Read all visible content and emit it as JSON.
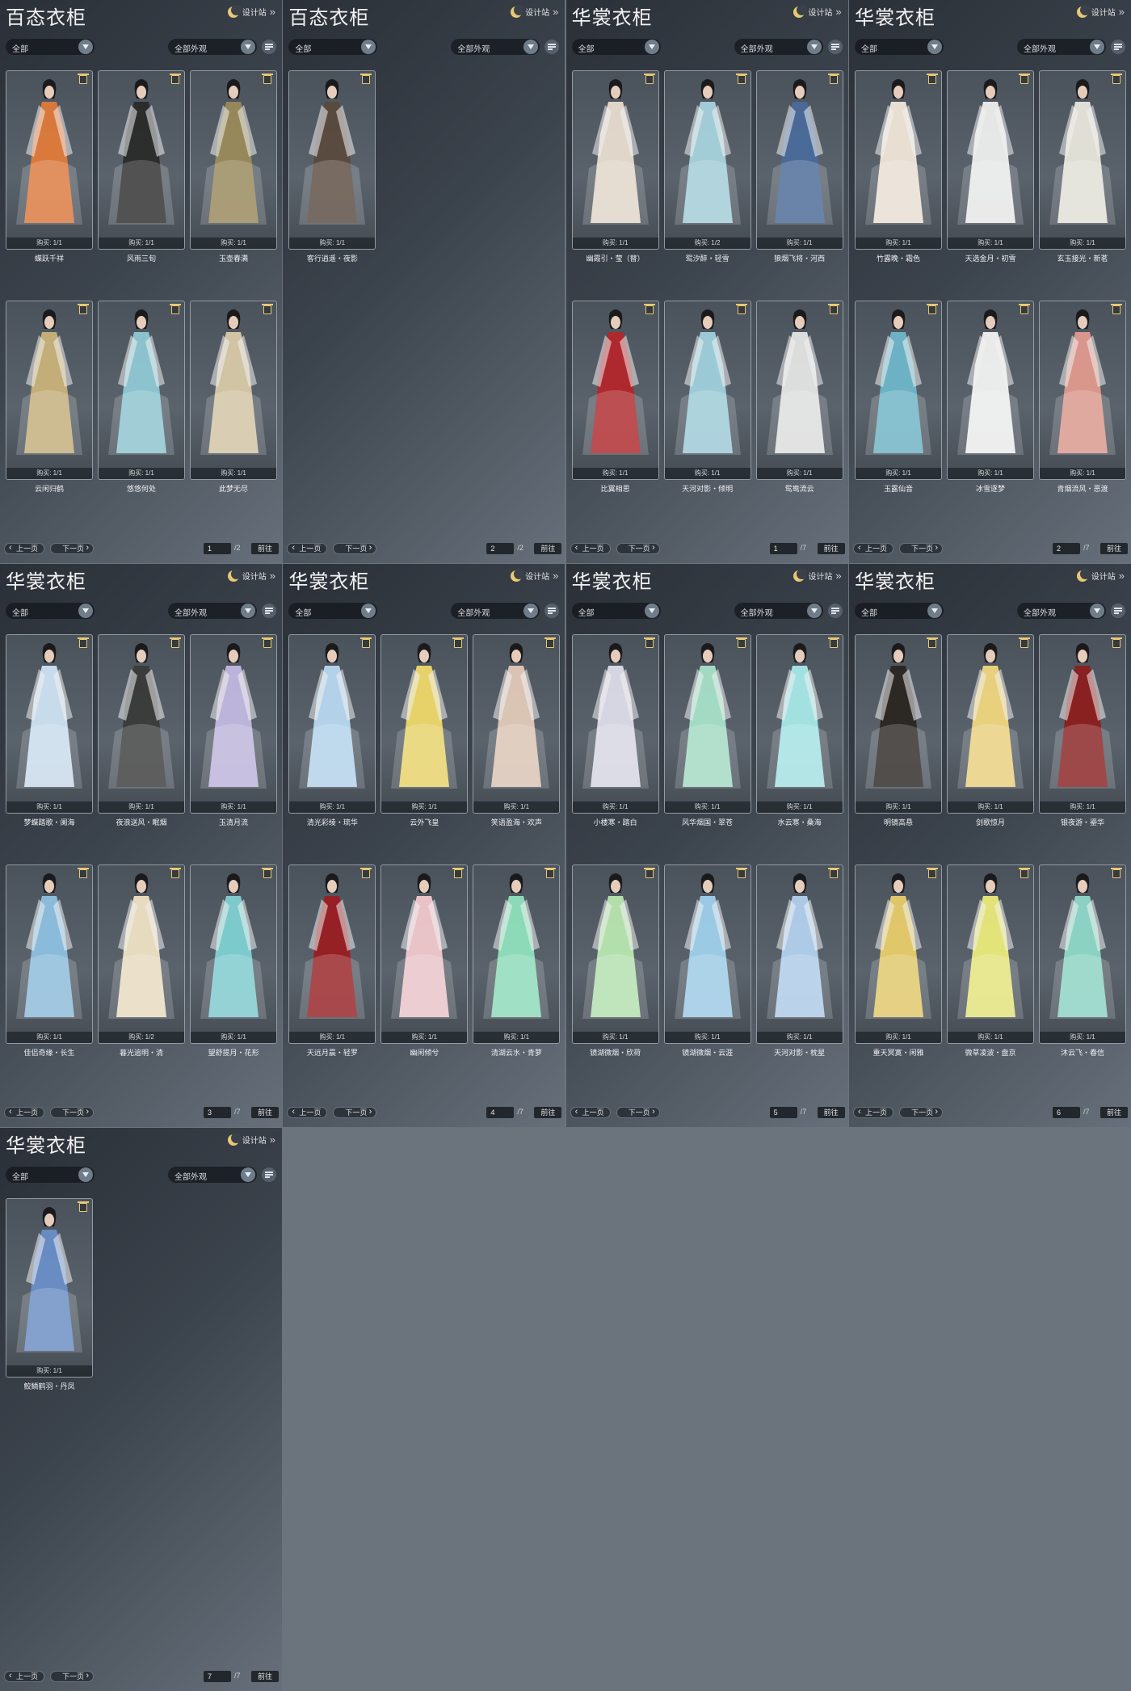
{
  "common": {
    "design_label": "设计站",
    "dropdown_left": "全部",
    "dropdown_right": "全部外观",
    "prev_label": "上一页",
    "next_label": "下一页",
    "jump_label": "前往"
  },
  "panels": [
    {
      "title": "百态衣柜",
      "page": "1",
      "total": "/2",
      "items": [
        {
          "name": "蝶跃千祥",
          "buy": "购买: 1/1",
          "accent": "#e07a3a"
        },
        {
          "name": "风雨三旬",
          "buy": "购买: 1/1",
          "accent": "#2a2a2a"
        },
        {
          "name": "玉壶春满",
          "buy": "购买: 1/1",
          "accent": "#9a8a5a"
        },
        {
          "name": "云闲归鹤",
          "buy": "购买: 1/1",
          "accent": "#c9b27a"
        },
        {
          "name": "悠悠何处",
          "buy": "购买: 1/1",
          "accent": "#8fc8d4"
        },
        {
          "name": "此梦无尽",
          "buy": "购买: 1/1",
          "accent": "#d8c9a8"
        }
      ]
    },
    {
      "title": "百态衣柜",
      "page": "2",
      "total": "/2",
      "items": [
        {
          "name": "客行逍遥・夜影",
          "buy": "购买: 1/1",
          "accent": "#5a4a3e"
        }
      ]
    },
    {
      "title": "华裳衣柜",
      "page": "1",
      "total": "/7",
      "items": [
        {
          "name": "幽霞引・莹（替）",
          "buy": "购买: 1/1",
          "accent": "#e8dccf"
        },
        {
          "name": "鸳汐醉・轻雪",
          "buy": "购买: 1/2",
          "accent": "#a6d2dc"
        },
        {
          "name": "狼烟飞将・河西",
          "buy": "购买: 1/1",
          "accent": "#4a6a9a"
        },
        {
          "name": "比翼相思",
          "buy": "购买: 1/1",
          "accent": "#b3262a"
        },
        {
          "name": "天河对影・倾明",
          "buy": "购买: 1/1",
          "accent": "#9fd0dc"
        },
        {
          "name": "鸳鸯流云",
          "buy": "购买: 1/1",
          "accent": "#e4e4e4"
        }
      ]
    },
    {
      "title": "华裳衣柜",
      "page": "2",
      "total": "/7",
      "items": [
        {
          "name": "竹露晚・霜色",
          "buy": "购买: 1/1",
          "accent": "#f0e6d8"
        },
        {
          "name": "天选金月・初雪",
          "buy": "购买: 1/1",
          "accent": "#eeeeee"
        },
        {
          "name": "玄玉接光・新茗",
          "buy": "购买: 1/1",
          "accent": "#e8e6dc"
        },
        {
          "name": "玉露仙音",
          "buy": "购买: 1/1",
          "accent": "#6fb6c9"
        },
        {
          "name": "冰雪逐梦",
          "buy": "购买: 1/1",
          "accent": "#f2f2f2"
        },
        {
          "name": "青烟流风・恶渡",
          "buy": "购买: 1/1",
          "accent": "#e09a8e"
        }
      ]
    },
    {
      "title": "华裳衣柜",
      "page": "3",
      "total": "/7",
      "items": [
        {
          "name": "梦蝶踏歌・阑海",
          "buy": "购买: 1/1",
          "accent": "#cfe2f2"
        },
        {
          "name": "夜浪送风・眠烟",
          "buy": "购买: 1/1",
          "accent": "#3a3a3a"
        },
        {
          "name": "玉清月流",
          "buy": "购买: 1/1",
          "accent": "#c2b8e0"
        },
        {
          "name": "佳侣奇缘・长生",
          "buy": "购买: 1/1",
          "accent": "#8ec0e0"
        },
        {
          "name": "暮光追明・清",
          "buy": "购买: 1/2",
          "accent": "#efe2c4"
        },
        {
          "name": "望舒揽月・花形",
          "buy": "购买: 1/1",
          "accent": "#7fd0d2"
        }
      ]
    },
    {
      "title": "华裳衣柜",
      "page": "4",
      "total": "/7",
      "items": [
        {
          "name": "清光彩绫・琉华",
          "buy": "购买: 1/1",
          "accent": "#b8d8f0"
        },
        {
          "name": "云外飞皇",
          "buy": "购买: 1/1",
          "accent": "#efd86a"
        },
        {
          "name": "笑语盈海・欢声",
          "buy": "购买: 1/1",
          "accent": "#e2c9b8"
        },
        {
          "name": "天远月晨・轻罗",
          "buy": "购买: 1/1",
          "accent": "#9a1e22"
        },
        {
          "name": "幽闲倾兮",
          "buy": "购买: 1/1",
          "accent": "#f0c8cc"
        },
        {
          "name": "清湖云水・青萝",
          "buy": "购买: 1/1",
          "accent": "#8fe0bc"
        }
      ]
    },
    {
      "title": "华裳衣柜",
      "page": "5",
      "total": "/7",
      "items": [
        {
          "name": "小楼寒・踏白",
          "buy": "购买: 1/1",
          "accent": "#dcdce8"
        },
        {
          "name": "风华烟国・翠苍",
          "buy": "购买: 1/1",
          "accent": "#a8e0c8"
        },
        {
          "name": "水云寒・桑海",
          "buy": "购买: 1/1",
          "accent": "#a8e8e8"
        },
        {
          "name": "镜湖微烟・欣荷",
          "buy": "购买: 1/1",
          "accent": "#b8e6b0"
        },
        {
          "name": "镜湖微烟・云涯",
          "buy": "购买: 1/1",
          "accent": "#9fd0ec"
        },
        {
          "name": "天河对影・枕星",
          "buy": "购买: 1/1",
          "accent": "#b2d0ee"
        }
      ]
    },
    {
      "title": "华裳衣柜",
      "page": "6",
      "total": "/7",
      "items": [
        {
          "name": "明镜高悬",
          "buy": "购买: 1/1",
          "accent": "#2a2622"
        },
        {
          "name": "剑歌惊月",
          "buy": "购买: 1/1",
          "accent": "#f0d67e"
        },
        {
          "name": "银夜游・鎏华",
          "buy": "购买: 1/1",
          "accent": "#8c1e1e"
        },
        {
          "name": "重天冥寞・闲雅",
          "buy": "购买: 1/1",
          "accent": "#e8cc6a"
        },
        {
          "name": "微草凌波・盘京",
          "buy": "购买: 1/1",
          "accent": "#eaea7a"
        },
        {
          "name": "沐云飞・春信",
          "buy": "购买: 1/1",
          "accent": "#8fd8c8"
        }
      ]
    },
    {
      "title": "华裳衣柜",
      "page": "7",
      "total": "/7",
      "items": [
        {
          "name": "鲛鳞鹤羽・丹凤",
          "buy": "购买: 1/1",
          "accent": "#6a8ec8"
        }
      ]
    }
  ]
}
